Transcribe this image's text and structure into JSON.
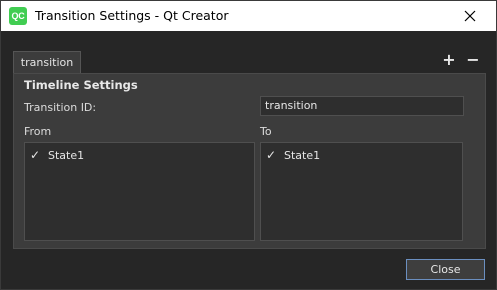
{
  "window": {
    "title": "Transition Settings - Qt Creator",
    "app_icon_text": "QC"
  },
  "tabs": [
    {
      "label": "transition"
    }
  ],
  "tab_actions": {
    "add": "+",
    "remove": "−"
  },
  "timeline": {
    "section_title": "Timeline Settings",
    "id_label": "Transition ID:",
    "id_value": "transition",
    "from_label": "From",
    "to_label": "To",
    "from_items": [
      {
        "check": "✓",
        "label": "State1"
      }
    ],
    "to_items": [
      {
        "check": "✓",
        "label": "State1"
      }
    ]
  },
  "footer": {
    "close_label": "Close"
  },
  "colors": {
    "accent": "#41cd52",
    "focus_border": "#6b8fc0"
  }
}
